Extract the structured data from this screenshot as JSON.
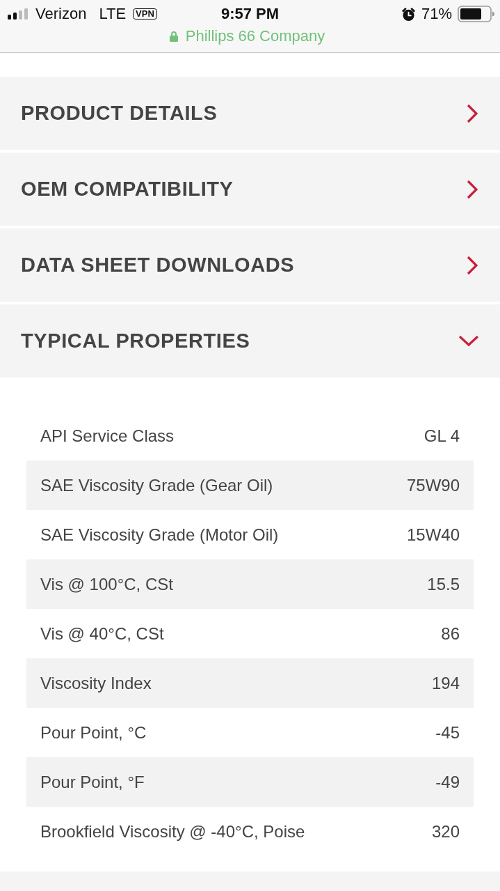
{
  "status_bar": {
    "carrier": "Verizon",
    "network": "LTE",
    "vpn": "VPN",
    "time": "9:57 PM",
    "battery": "71%"
  },
  "address_bar": {
    "site": "Phillips 66 Company",
    "secure": true
  },
  "sections": [
    {
      "title": "PRODUCT DETAILS",
      "expanded": false
    },
    {
      "title": "OEM COMPATIBILITY",
      "expanded": false
    },
    {
      "title": "DATA SHEET DOWNLOADS",
      "expanded": false
    },
    {
      "title": "TYPICAL PROPERTIES",
      "expanded": true,
      "rows": [
        {
          "name": "API Service Class",
          "value": "GL 4"
        },
        {
          "name": "SAE Viscosity Grade (Gear Oil)",
          "value": "75W90"
        },
        {
          "name": "SAE Viscosity Grade (Motor Oil)",
          "value": "15W40"
        },
        {
          "name": "Vis @ 100°C, CSt",
          "value": "15.5"
        },
        {
          "name": "Vis @ 40°C, CSt",
          "value": "86"
        },
        {
          "name": "Viscosity Index",
          "value": "194"
        },
        {
          "name": "Pour Point, °C",
          "value": "-45"
        },
        {
          "name": "Pour Point, °F",
          "value": "-49"
        },
        {
          "name": "Brookfield Viscosity @ -40°C, Poise",
          "value": "320"
        }
      ]
    }
  ]
}
